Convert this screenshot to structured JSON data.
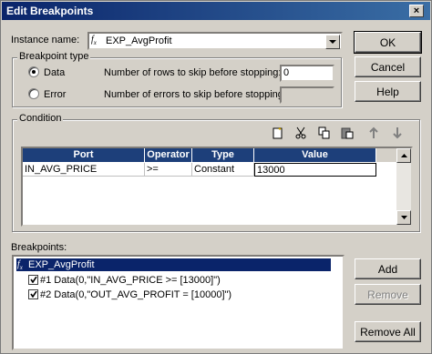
{
  "window": {
    "title": "Edit Breakpoints",
    "close_glyph": "×"
  },
  "instance": {
    "label": "Instance name:",
    "value": "EXP_AvgProfit"
  },
  "buttons": {
    "ok": "OK",
    "cancel": "Cancel",
    "help": "Help",
    "add": "Add",
    "remove": "Remove",
    "remove_all": "Remove All"
  },
  "breakpoint_type": {
    "title": "Breakpoint type",
    "data_label": "Data",
    "error_label": "Error",
    "selected": "Data",
    "rows_skip_label": "Number of rows to skip before stopping:",
    "rows_skip_value": "0",
    "errors_skip_label": "Number of errors to skip before stopping:",
    "errors_skip_value": ""
  },
  "condition": {
    "title": "Condition",
    "columns": [
      "Port",
      "Operator",
      "Type",
      "Value"
    ],
    "rows": [
      {
        "port": "IN_AVG_PRICE",
        "operator": ">=",
        "type": "Constant",
        "value": "13000"
      }
    ]
  },
  "breakpoints": {
    "label": "Breakpoints:",
    "root": "EXP_AvgProfit",
    "items": [
      {
        "label": "#1 Data(0,\"IN_AVG_PRICE >= [13000]\")",
        "checked": true
      },
      {
        "label": "#2 Data(0,\"OUT_AVG_PROFIT = [10000]\")",
        "checked": true
      }
    ]
  },
  "colors": {
    "title_bar": "#0a246a",
    "grid_header": "#1d3f7a",
    "selection": "#0a246a"
  }
}
